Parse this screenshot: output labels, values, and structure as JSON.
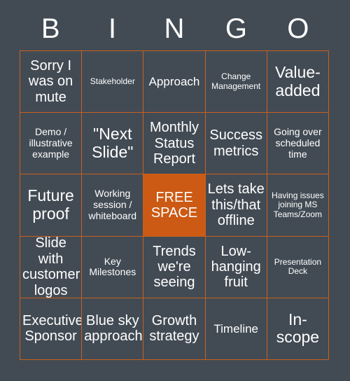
{
  "card": {
    "header_letters": [
      "B",
      "I",
      "N",
      "G",
      "O"
    ],
    "colors": {
      "background": "#424b54",
      "cell_fill": "#424b54",
      "border": "#c8601e",
      "free_space_fill": "#cc5a14",
      "text": "#ffffff"
    },
    "rows": [
      [
        {
          "text": "Sorry I was on mute",
          "size": "lg",
          "free": false
        },
        {
          "text": "Stakeholder",
          "size": "xs",
          "free": false
        },
        {
          "text": "Approach",
          "size": "md",
          "free": false
        },
        {
          "text": "Change Management",
          "size": "xs",
          "free": false
        },
        {
          "text": "Value-added",
          "size": "xl",
          "free": false
        }
      ],
      [
        {
          "text": "Demo / illustrative example",
          "size": "sm",
          "free": false
        },
        {
          "text": "\"Next Slide\"",
          "size": "xl",
          "free": false
        },
        {
          "text": "Monthly Status Report",
          "size": "lg",
          "free": false
        },
        {
          "text": "Success metrics",
          "size": "lg",
          "free": false
        },
        {
          "text": "Going over scheduled time",
          "size": "sm",
          "free": false
        }
      ],
      [
        {
          "text": "Future proof",
          "size": "xl",
          "free": false
        },
        {
          "text": "Working session / whiteboard",
          "size": "sm",
          "free": false
        },
        {
          "text": "FREE SPACE",
          "size": "lg",
          "free": true
        },
        {
          "text": "Lets take this/that offline",
          "size": "lg",
          "free": false
        },
        {
          "text": "Having issues joining MS Teams/Zoom",
          "size": "xs",
          "free": false
        }
      ],
      [
        {
          "text": "Slide with customer logos",
          "size": "lg",
          "free": false
        },
        {
          "text": "Key Milestones",
          "size": "sm",
          "free": false
        },
        {
          "text": "Trends we're seeing",
          "size": "lg",
          "free": false
        },
        {
          "text": "Low-hanging fruit",
          "size": "lg",
          "free": false
        },
        {
          "text": "Presentation Deck",
          "size": "xs",
          "free": false
        }
      ],
      [
        {
          "text": "Executive Sponsor",
          "size": "lg",
          "free": false
        },
        {
          "text": "Blue sky approach",
          "size": "lg",
          "free": false
        },
        {
          "text": "Growth strategy",
          "size": "lg",
          "free": false
        },
        {
          "text": "Timeline",
          "size": "md",
          "free": false
        },
        {
          "text": "In-scope",
          "size": "xl",
          "free": false
        }
      ]
    ]
  }
}
